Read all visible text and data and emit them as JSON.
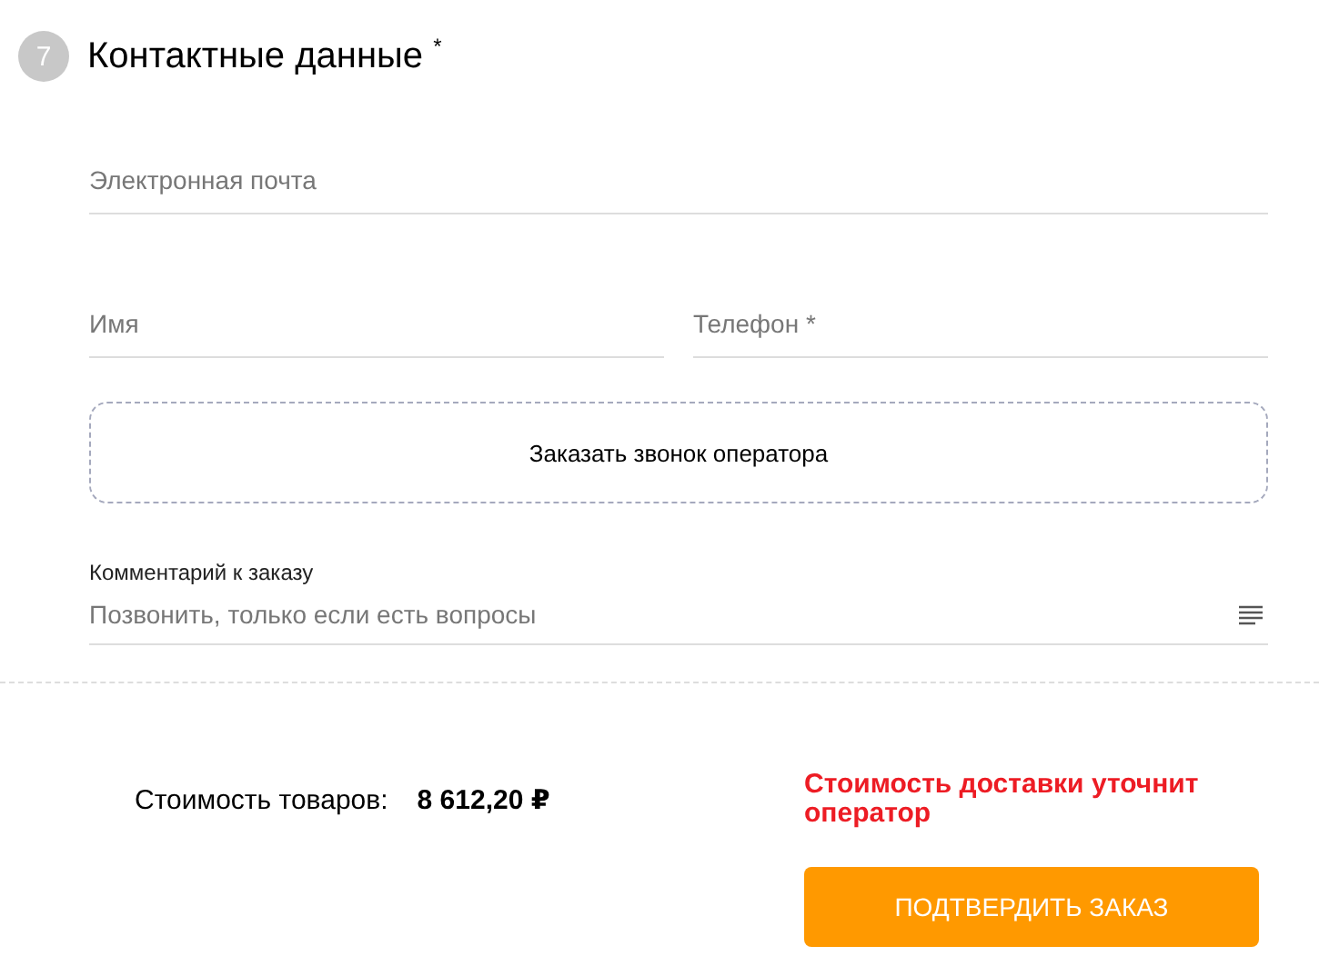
{
  "step": {
    "number": "7",
    "title": "Контактные данные $^{*}$"
  },
  "email_field": {
    "placeholder": "Электронная почта"
  },
  "name_field": {
    "placeholder": "Имя"
  },
  "phone_field": {
    "placeholder": "Телефон *"
  },
  "callback_button": "Заказать звонок оператора",
  "comment": {
    "label": "Комментарий к заказу",
    "placeholder": "Позвонить, только если есть вопросы"
  },
  "summary": {
    "label": "Стоимость товаров:",
    "value": "8 612,20 ₽",
    "delivery_note": "Стоимость доставки уточнит оператор"
  },
  "confirm_button": "ПОДТВЕРДИТЬ ЗАКАЗ"
}
